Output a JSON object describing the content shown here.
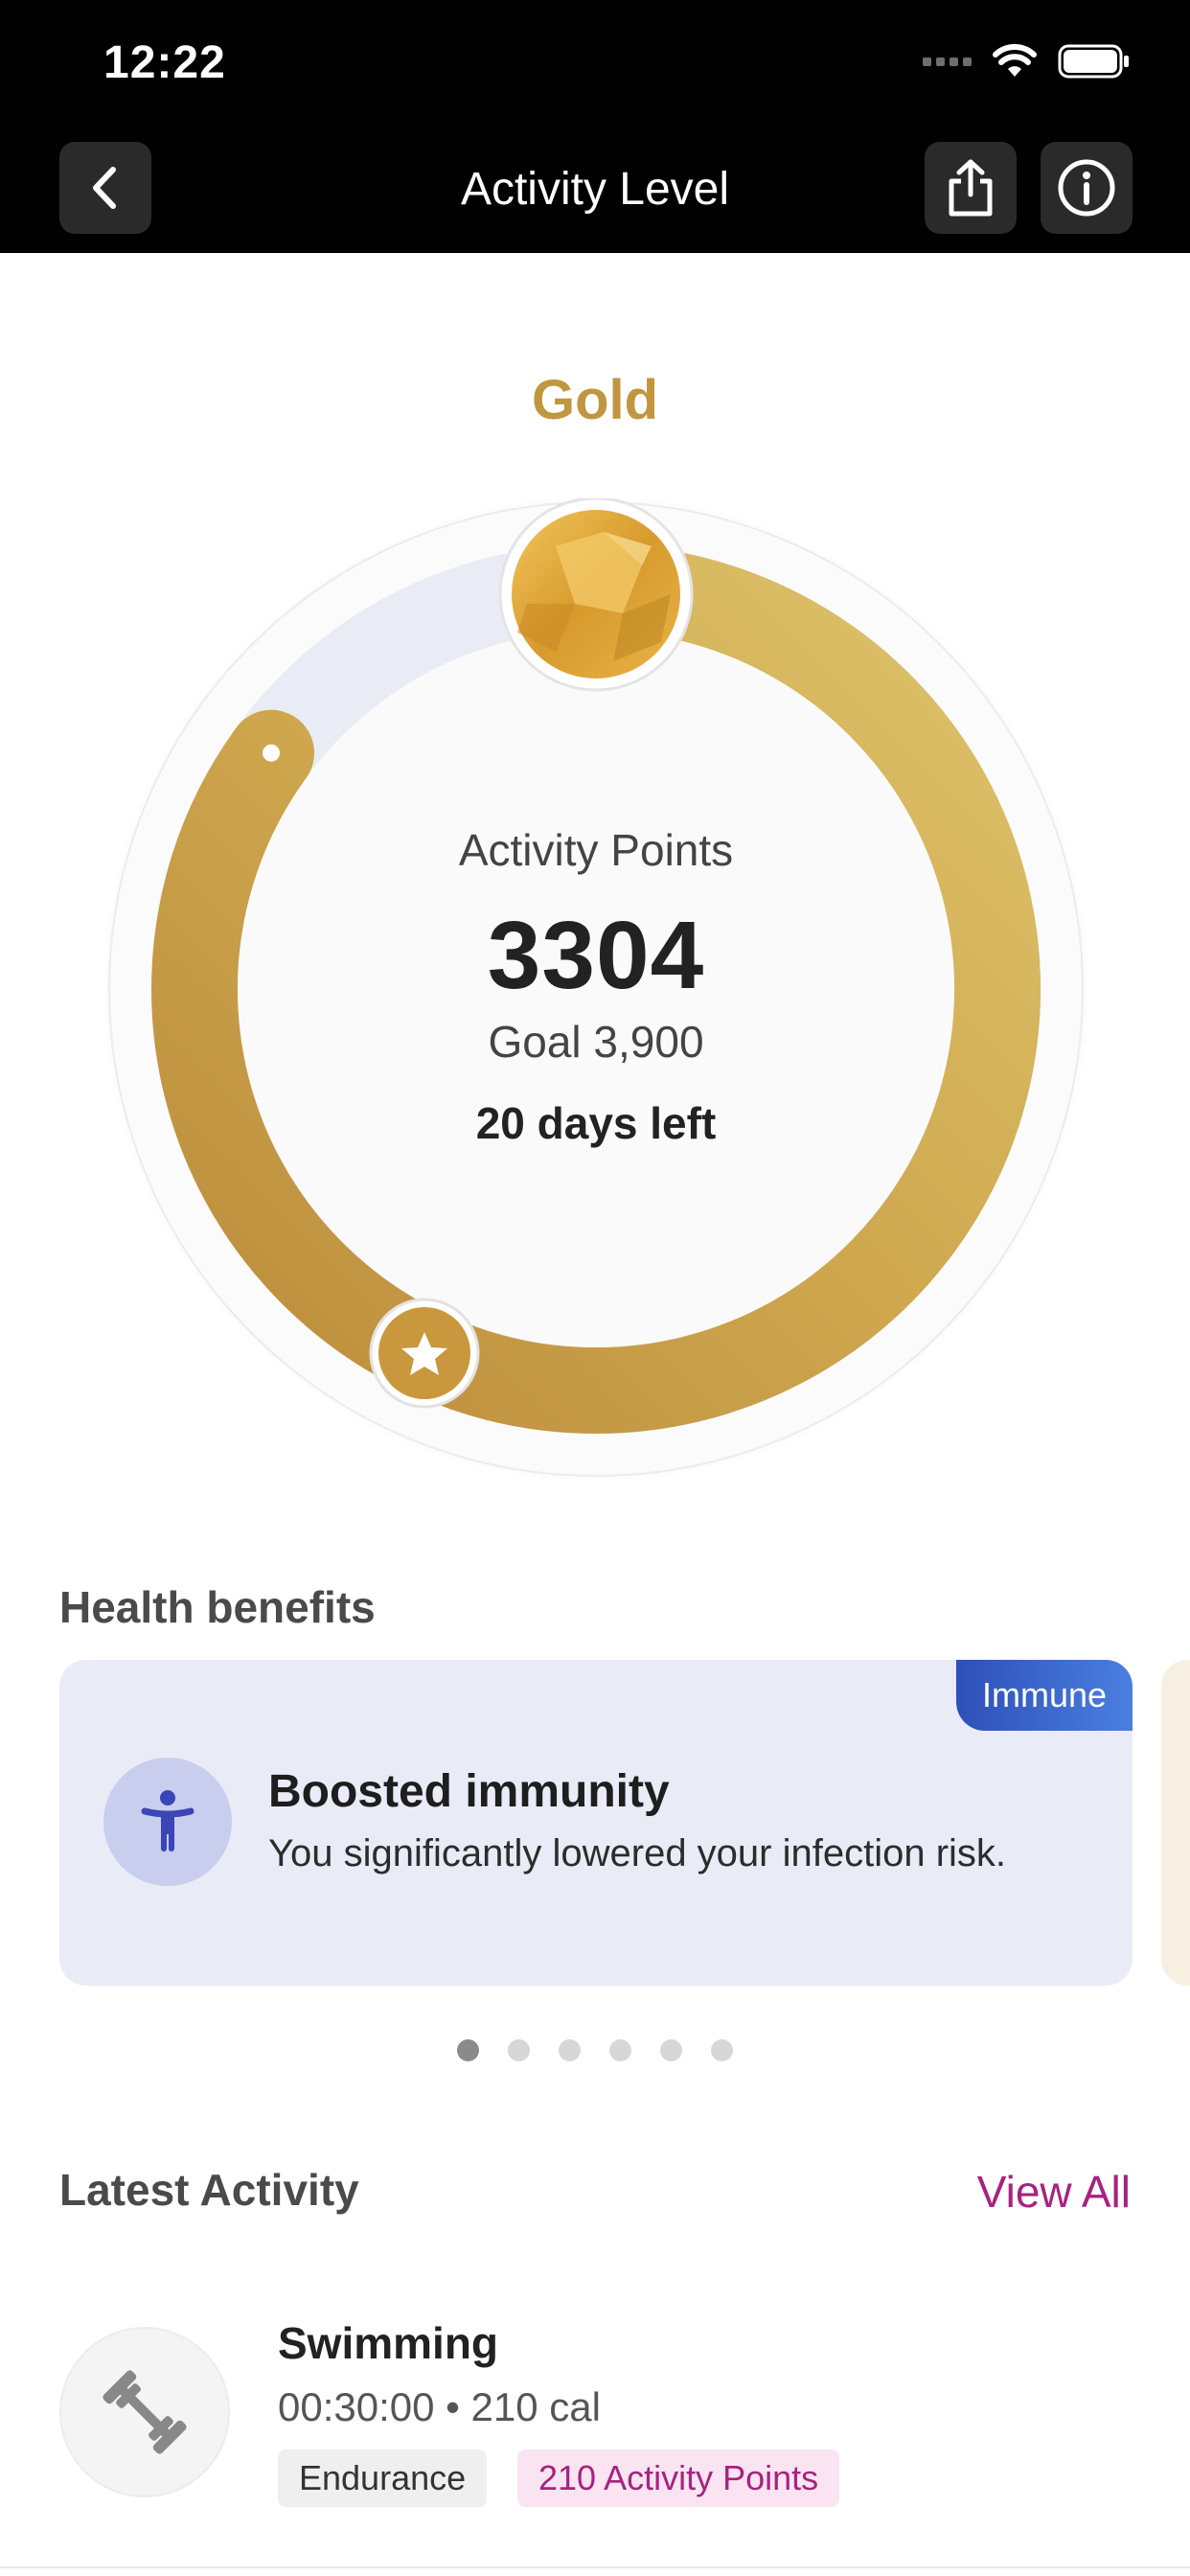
{
  "status_bar": {
    "time": "12:22"
  },
  "nav": {
    "title": "Activity Level"
  },
  "level": {
    "name": "Gold",
    "accent": "#c0963f"
  },
  "ring": {
    "label": "Activity Points",
    "points": "3304",
    "goal": "Goal 3,900",
    "days_left": "20 days left",
    "progress_fraction": 0.85
  },
  "health_benefits": {
    "title": "Health benefits",
    "card": {
      "tag": "Immune",
      "title": "Boosted immunity",
      "description": "You significantly lowered your infection risk."
    },
    "page_count": 6,
    "active_page": 1
  },
  "latest_activity": {
    "title": "Latest Activity",
    "view_all": "View All",
    "item": {
      "title": "Swimming",
      "meta": "00:30:00 • 210 cal",
      "tag1": "Endurance",
      "tag2": "210 Activity Points"
    }
  }
}
